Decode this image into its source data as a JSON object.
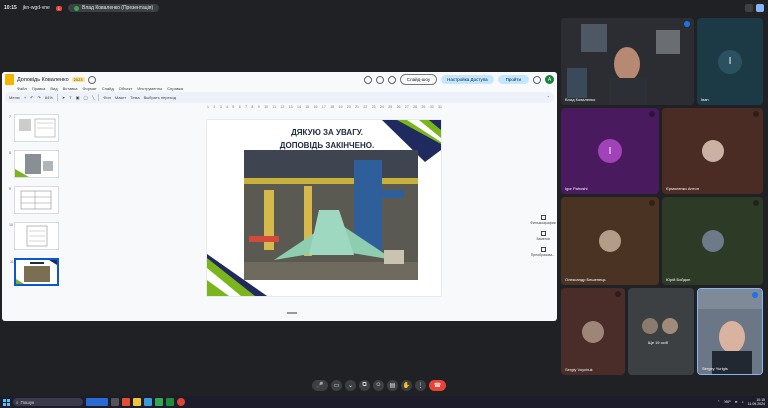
{
  "topbar": {
    "time": "10:15",
    "meeting_code": "jkn-wgd-vne",
    "badge": "1",
    "tab_title": "Влад Коваленко (Презентація)"
  },
  "slides_app": {
    "doc_title": "Доповідь Коваленко",
    "doc_badge": "2023",
    "menu": [
      "Файл",
      "Правка",
      "Вид",
      "Вставка",
      "Формат",
      "Слайд",
      "Объект",
      "Инструменты",
      "Справка"
    ],
    "slideshow_button": "Слайд-шоу",
    "access_button": "Настройка Доступа",
    "share_button": "Пройти",
    "avatar_initial": "А",
    "toolbar": {
      "search": "Меню",
      "zoom": "84%",
      "background": "Фон",
      "layout": "Макет",
      "theme": "Тема",
      "transition": "Выбрать переход"
    },
    "ruler": [
      "1",
      "2",
      "3",
      "4",
      "5",
      "6",
      "7",
      "8",
      "9",
      "10",
      "11",
      "12",
      "13",
      "14",
      "15",
      "16",
      "17",
      "18",
      "19",
      "20",
      "21",
      "22",
      "23",
      "24",
      "25",
      "26",
      "27",
      "28",
      "29",
      "30",
      "31"
    ],
    "thumbnails": [
      "7",
      "8",
      "9",
      "10",
      "11"
    ],
    "selected_thumbnail": "11",
    "slide": {
      "title_line1": "ДЯКУЮ ЗА УВАГУ.",
      "title_line2": "ДОПОВІДЬ ЗАКІНЧЕНО."
    },
    "side_tools": [
      "Фильмоарафии",
      "Заметки",
      "Преобразова..."
    ]
  },
  "participants": [
    {
      "name": "Влад Коваленко",
      "type": "video",
      "bg": "#3a3d44",
      "mic_active": true
    },
    {
      "name": "Іван",
      "type": "initial",
      "initial": "І",
      "bg": "#1b3a45",
      "circle": "#1b3a45",
      "mic_active": false
    },
    {
      "name": "Igor Pahoshi",
      "type": "initial",
      "initial": "I",
      "bg": "#4a1a5e",
      "circle": "#a142b8",
      "mic_active": false
    },
    {
      "name": "Єрмоленко Антон",
      "type": "face",
      "bg": "#4a2c24",
      "mic_active": false
    },
    {
      "name": "Олександр Бешенець",
      "type": "face",
      "bg": "#4b3324",
      "mic_active": false
    },
    {
      "name": "Юрій Бойдон",
      "type": "face",
      "bg": "#2c3a26",
      "mic_active": false
    },
    {
      "name": "Sergiy Voychuk",
      "type": "face",
      "bg": "#4a2c28",
      "mic_active": false
    },
    {
      "name": "Ще 19 осіб",
      "type": "group",
      "bg": "#3c4043",
      "mic_active": false
    },
    {
      "name": "Sergey Yurigis",
      "type": "video",
      "bg": "#556070",
      "mic_active": true
    }
  ],
  "controls": [
    "mic",
    "cam",
    "more",
    "present",
    "emoji",
    "captions",
    "hand",
    "more-options",
    "end-call"
  ],
  "taskbar": {
    "search_placeholder": "Пошук",
    "lang": "УКР",
    "time": "10:15",
    "date": "11.09.2024"
  },
  "colors": {
    "accent_green": "#7ab51d",
    "accent_navy": "#1f2a5e",
    "meet_blue": "#1a73e8",
    "end_call_red": "#ea4335"
  }
}
